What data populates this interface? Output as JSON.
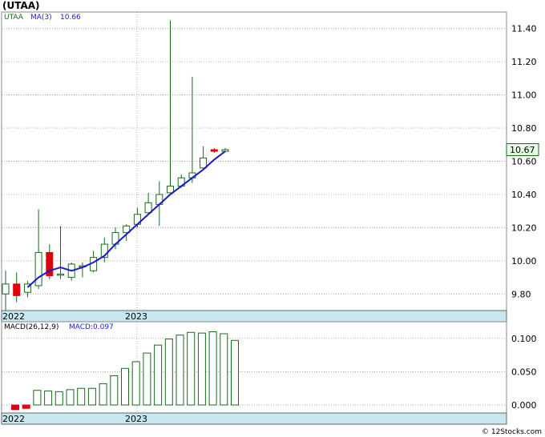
{
  "header": {
    "title": "(UTAA)"
  },
  "footer": {
    "copyright": "© 12Stocks.com"
  },
  "main_panel": {
    "ticker": "UTAA",
    "ma_label": "MA(3)",
    "ma_value": "10.66",
    "last_price_label": "10.67",
    "x_labels": [
      "2022",
      "2023"
    ]
  },
  "macd_panel": {
    "label": "MACD(26,12,9)",
    "value_label": "MACD:0.097",
    "x_labels": [
      "2022",
      "2023"
    ]
  },
  "colors": {
    "up": "#ffffff",
    "down": "#e0000d",
    "candle_outline": "#1a6a1a",
    "ma_line": "#1a1acc",
    "grid": "#888888",
    "date_band": "#c5e8f0",
    "macd_bar": "#1a6a1a"
  },
  "chart_data": [
    {
      "type": "candlestick",
      "series_name": "UTAA",
      "ylim": [
        9.7,
        11.5
      ],
      "yticks": [
        "9.80",
        "10.00",
        "10.20",
        "10.40",
        "10.60",
        "10.80",
        "11.00",
        "11.20",
        "11.40"
      ],
      "grid": true,
      "ohlc": [
        {
          "o": 9.8,
          "h": 9.94,
          "l": 9.7,
          "c": 9.86
        },
        {
          "o": 9.86,
          "h": 9.93,
          "l": 9.75,
          "c": 9.79
        },
        {
          "o": 9.81,
          "h": 9.88,
          "l": 9.78,
          "c": 9.86
        },
        {
          "o": 9.85,
          "h": 10.31,
          "l": 9.83,
          "c": 10.05
        },
        {
          "o": 10.05,
          "h": 10.1,
          "l": 9.89,
          "c": 9.91
        },
        {
          "o": 9.92,
          "h": 10.21,
          "l": 9.89,
          "c": 9.92
        },
        {
          "o": 9.9,
          "h": 9.99,
          "l": 9.88,
          "c": 9.98
        },
        {
          "o": 9.97,
          "h": 9.99,
          "l": 9.9,
          "c": 9.97
        },
        {
          "o": 9.94,
          "h": 10.06,
          "l": 9.93,
          "c": 10.02
        },
        {
          "o": 10.02,
          "h": 10.14,
          "l": 9.99,
          "c": 10.1
        },
        {
          "o": 10.1,
          "h": 10.2,
          "l": 10.07,
          "c": 10.17
        },
        {
          "o": 10.17,
          "h": 10.22,
          "l": 10.12,
          "c": 10.21
        },
        {
          "o": 10.22,
          "h": 10.32,
          "l": 10.2,
          "c": 10.28
        },
        {
          "o": 10.29,
          "h": 10.41,
          "l": 10.28,
          "c": 10.35
        },
        {
          "o": 10.34,
          "h": 10.48,
          "l": 10.21,
          "c": 10.4
        },
        {
          "o": 10.41,
          "h": 11.45,
          "l": 10.4,
          "c": 10.45
        },
        {
          "o": 10.45,
          "h": 10.52,
          "l": 10.44,
          "c": 10.5
        },
        {
          "o": 10.5,
          "h": 11.11,
          "l": 10.47,
          "c": 10.53
        },
        {
          "o": 10.56,
          "h": 10.69,
          "l": 10.55,
          "c": 10.62
        },
        {
          "o": 10.67,
          "h": 10.68,
          "l": 10.65,
          "c": 10.66
        },
        {
          "o": 10.66,
          "h": 10.68,
          "l": 10.66,
          "c": 10.67
        }
      ],
      "ma3": [
        null,
        null,
        9.84,
        9.9,
        9.94,
        9.96,
        9.94,
        9.96,
        9.99,
        10.03,
        10.1,
        10.16,
        10.22,
        10.28,
        10.34,
        10.4,
        10.45,
        10.5,
        10.55,
        10.61,
        10.66
      ]
    },
    {
      "type": "bar",
      "series_name": "MACD(26,12,9)",
      "ylim": [
        -0.012,
        0.125
      ],
      "yticks": [
        "0.000",
        "0.050",
        "0.100"
      ],
      "grid": true,
      "values": [
        -0.007,
        -0.005,
        0.022,
        0.021,
        0.02,
        0.023,
        0.025,
        0.025,
        0.032,
        0.044,
        0.055,
        0.065,
        0.078,
        0.09,
        0.099,
        0.105,
        0.109,
        0.108,
        0.11,
        0.107,
        0.097
      ]
    }
  ]
}
